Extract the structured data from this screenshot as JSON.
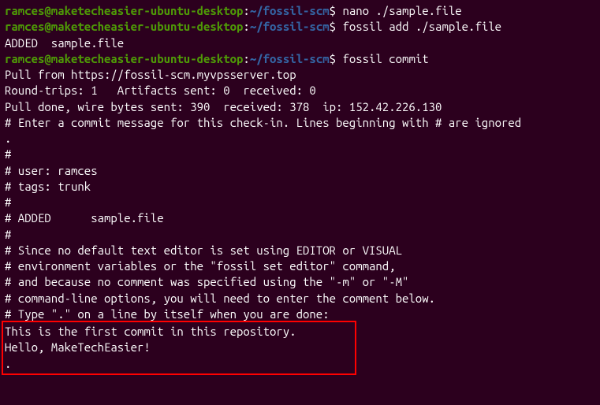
{
  "prompt": {
    "user_host": "ramces@maketecheasier-ubuntu-desktop",
    "colon": ":",
    "path": "~/fossil-scm",
    "dollar": "$ "
  },
  "commands": {
    "nano": "nano ./sample.file",
    "fossil_add": "fossil add ./sample.file",
    "fossil_commit": "fossil commit"
  },
  "output": {
    "added": "ADDED  sample.file",
    "pull_from": "Pull from https://fossil-scm.myvpsserver.top",
    "round_trips": "Round-trips: 1   Artifacts sent: 0  received: 0",
    "pull_done": "Pull done, wire bytes sent: 390  received: 378  ip: 152.42.226.130",
    "blank": "",
    "comment_header": "# Enter a commit message for this check-in. Lines beginning with # are ignored",
    "period": ".",
    "hash1": "#",
    "user": "# user: ramces",
    "tags": "# tags: trunk",
    "hash2": "#",
    "added_file": "# ADDED      sample.file",
    "hash3": "#",
    "editor1": "# Since no default text editor is set using EDITOR or VISUAL",
    "editor2": "# environment variables or the \"fossil set editor\" command,",
    "editor3": "# and because no comment was specified using the \"-m\" or \"-M\"",
    "editor4": "# command-line options, you will need to enter the comment below.",
    "editor5": "# Type \".\" on a line by itself when you are done:",
    "commit_msg1": "This is the first commit in this repository.",
    "commit_msg2": "Hello, MakeTechEasier!",
    "commit_end": "."
  }
}
